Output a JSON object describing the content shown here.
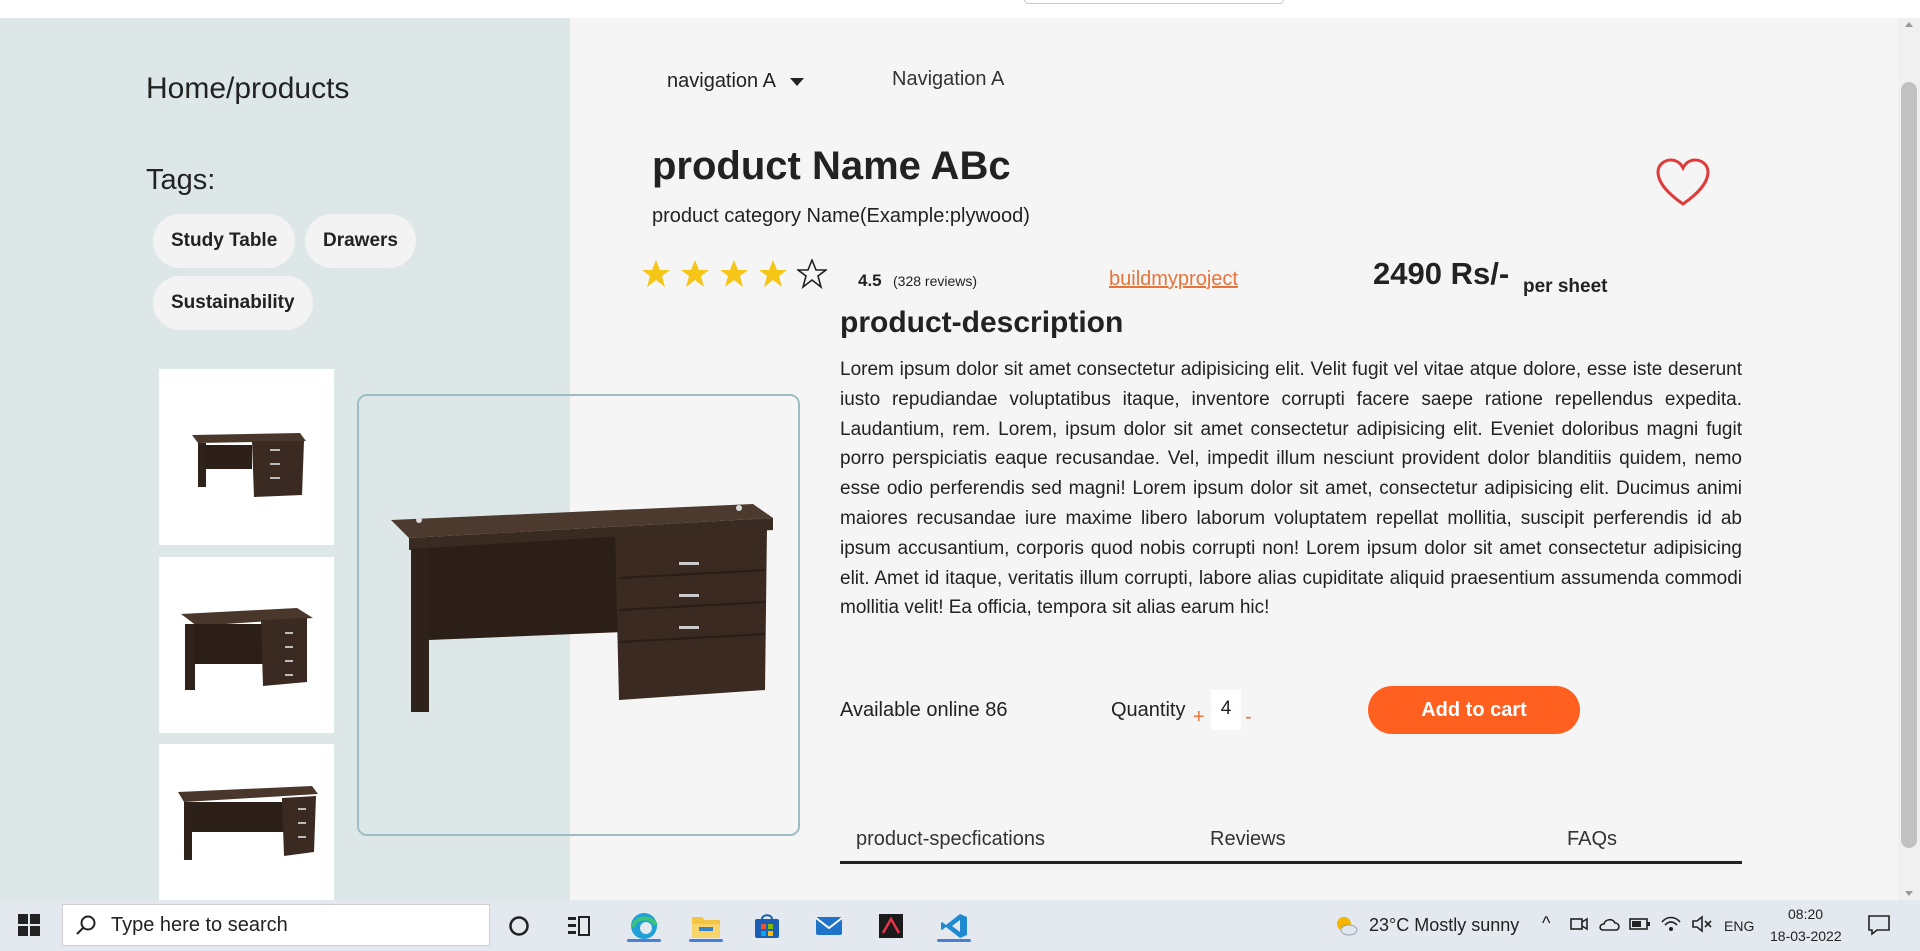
{
  "breadcrumb": "Home/products",
  "tags_title": "Tags:",
  "tags": [
    "Study Table",
    "Drawers",
    "Sustainability"
  ],
  "nav": {
    "dropdown_label": "navigation A",
    "link_label": "Navigation A"
  },
  "product": {
    "name": "product Name ABc",
    "category": "product category Name(Example:plywood)",
    "rating": "4.5",
    "rating_count": "(328 reviews)",
    "stars_filled": 4,
    "stars_total": 5,
    "brand_link": "buildmyproject",
    "price": "2490 Rs/-",
    "price_unit": "per sheet"
  },
  "description": {
    "title": "product-description",
    "text": "Lorem ipsum dolor sit amet consectetur adipisicing elit. Velit fugit vel vitae atque dolore, esse iste deserunt iusto repudiandae voluptatibus itaque, inventore corrupti facere saepe ratione repellendus expedita. Laudantium, rem. Lorem, ipsum dolor sit amet consectetur adipisicing elit. Eveniet doloribus magni fugit porro perspiciatis eaque recusandae. Vel, impedit illum nesciunt provident dolor blanditiis quidem, nemo esse odio perferendis sed magni! Lorem ipsum dolor sit amet, consectetur adipisicing elit. Ducimus animi maiores recusandae iure maxime libero laborum voluptatem repellat mollitia, suscipit perferendis id ab ipsum accusantium, corporis quod nobis corrupti non! Lorem ipsum dolor sit amet consectetur adipisicing elit. Amet id itaque, veritatis illum corrupti, labore alias cupiditate aliquid praesentium assumenda commodi mollitia velit! Ea officia, tempora sit alias earum hic!"
  },
  "purchase": {
    "available": "Available online 86",
    "quantity_label": "Quantity",
    "plus": "+",
    "quantity_value": "4",
    "minus": "-",
    "add_to_cart": "Add to cart"
  },
  "tabs": [
    "product-specfications",
    "Reviews",
    "FAQs"
  ],
  "taskbar": {
    "search_placeholder": "Type here to search",
    "weather": "23°C  Mostly sunny",
    "language": "ENG",
    "time": "08:20",
    "date": "18-03-2022"
  },
  "colors": {
    "accent": "#ff5f1f",
    "link": "#e8743b",
    "star": "#f5c518",
    "heart": "#e03a3a",
    "left_panel": "#dde7e8"
  }
}
